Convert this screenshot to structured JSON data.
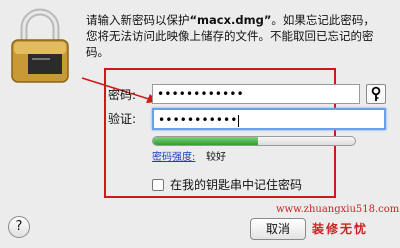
{
  "message": {
    "line1_prefix": "请输入新密码以保护",
    "file_name": "“macx.dmg”",
    "line1_suffix": "。如果忘记此密码，",
    "line2": "您将无法访问此映像上储存的文件。不能取回已忘记的密码。"
  },
  "form": {
    "password_label": "密码:",
    "password_value": "••••••••••••",
    "verify_label": "验证:",
    "verify_value": "•••••••••••",
    "strength_label": "密码强度:",
    "strength_value": "较好",
    "strength_level": 0.52
  },
  "remember_label": "在我的钥匙串中记住密码",
  "buttons": {
    "help": "?",
    "cancel": "取消"
  },
  "watermark": {
    "url": "www.zhuangxiu518.com",
    "title": "装修无忧"
  },
  "colors": {
    "annotation": "#d01818",
    "focus": "#6aa0e6",
    "strength": "#2f9e2f"
  },
  "icons": {
    "lock": "lock-icon",
    "key": "key-icon"
  }
}
